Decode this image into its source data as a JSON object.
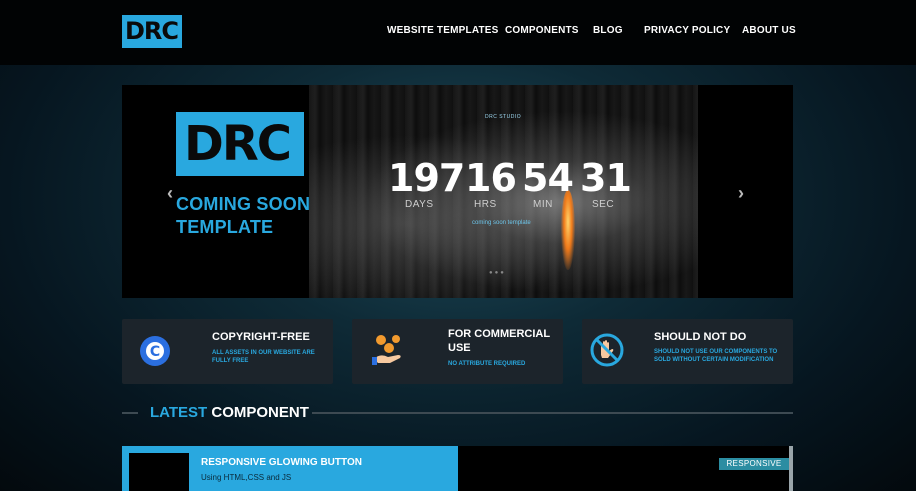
{
  "brand": {
    "logo_text": "DRC"
  },
  "nav": {
    "items": [
      {
        "label": "WEBSITE TEMPLATES"
      },
      {
        "label": "COMPONENTS"
      },
      {
        "label": "BLOG"
      },
      {
        "label": "PRIVACY POLICY"
      },
      {
        "label": "ABOUT US"
      }
    ]
  },
  "hero": {
    "logo_text": "DRC",
    "title": "COMING SOON TEMPLATE",
    "studio_label": "DRC STUDIO",
    "countdown": [
      {
        "value": "197",
        "unit": "DAYS"
      },
      {
        "value": "16",
        "unit": "HRS"
      },
      {
        "value": "54",
        "unit": "MIN"
      },
      {
        "value": "31",
        "unit": "SEC"
      }
    ],
    "tagline": "coming soon template",
    "prev_icon": "chevron-left-icon",
    "next_icon": "chevron-right-icon"
  },
  "features": [
    {
      "icon": "copyright-icon",
      "title": "COPYRIGHT-FREE",
      "subtitle": "ALL ASSETS IN OUR WEBSITE ARE FULLY FREE"
    },
    {
      "icon": "coins-hand-icon",
      "title": "FOR COMMERCIAL USE",
      "subtitle": "NO ATTRIBUTE REQUIRED"
    },
    {
      "icon": "no-hand-icon",
      "title": "SHOULD NOT DO",
      "subtitle": "SHOULD NOT USE OUR COMPONENTS TO SOLD WITHOUT CERTAIN MODIFICATION"
    }
  ],
  "latest": {
    "title_accent": "LATEST",
    "title_rest": "COMPONENT",
    "items": [
      {
        "title": "RESPONSIVE GLOWING BUTTON",
        "subtitle": "Using HTML,CSS and JS",
        "tag": "RESPONSIVE"
      }
    ]
  },
  "colors": {
    "accent": "#29a8df",
    "card_bg": "#1c242b",
    "tag_bg": "#2b8da2"
  }
}
